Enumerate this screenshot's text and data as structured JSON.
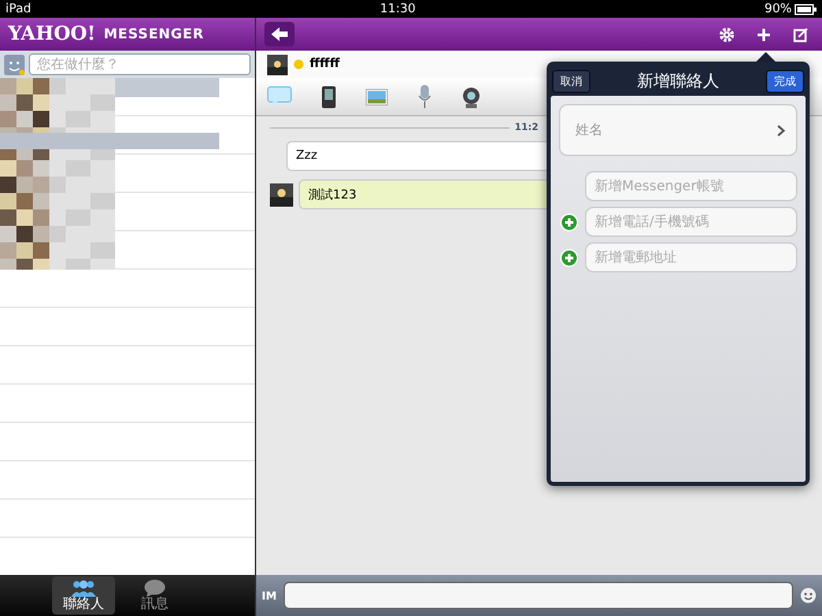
{
  "status_bar": {
    "carrier": "iPad",
    "time": "11:30",
    "battery": "90%"
  },
  "sidebar": {
    "logo": {
      "brand": "YAHOO!",
      "product": "MESSENGER"
    },
    "status_field": {
      "placeholder": "您在做什麼？"
    },
    "tabs": [
      {
        "label": "聯絡人",
        "selected": true
      },
      {
        "label": "訊息",
        "selected": false
      }
    ]
  },
  "chat": {
    "contact_name": "ffffff",
    "timestamp": "11:2",
    "messages": [
      {
        "kind": "sent",
        "text": "Zzz"
      },
      {
        "kind": "received",
        "text": "測試123"
      }
    ],
    "input": {
      "mode": "IM"
    }
  },
  "popover": {
    "title": "新增聯絡人",
    "cancel": "取消",
    "done": "完成",
    "fields": [
      {
        "kind": "name",
        "label": "姓名"
      },
      {
        "kind": "field",
        "placeholder": "新增Messenger帳號",
        "add_button": false
      },
      {
        "kind": "field",
        "placeholder": "新增電話/手機號碼",
        "add_button": true
      },
      {
        "kind": "field",
        "placeholder": "新增電郵地址",
        "add_button": true
      }
    ]
  }
}
